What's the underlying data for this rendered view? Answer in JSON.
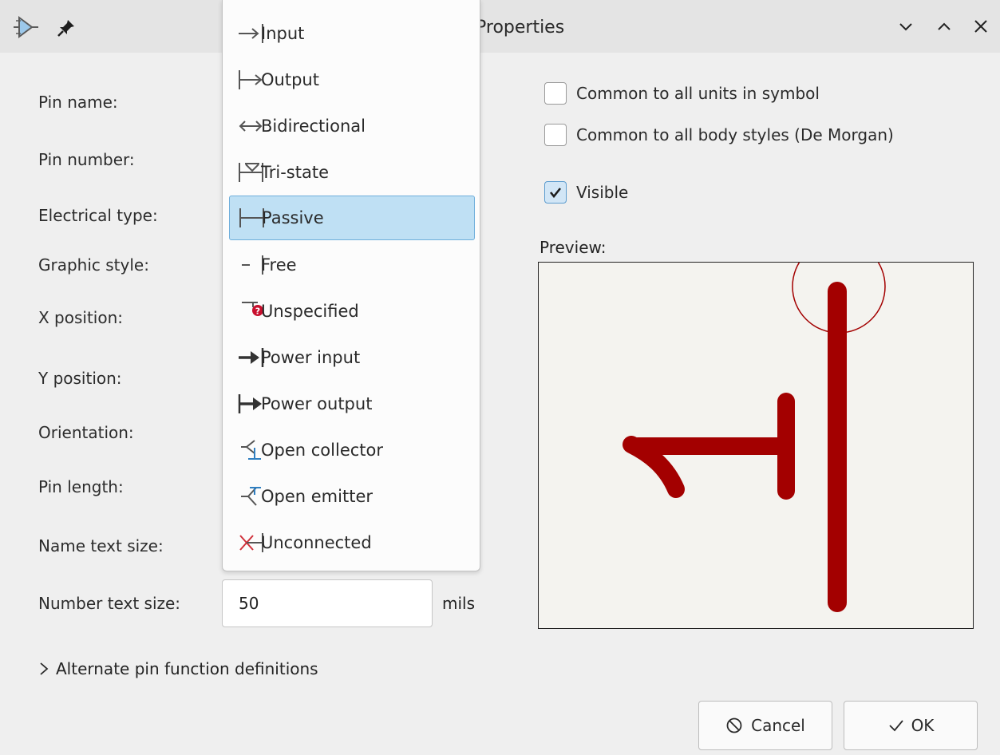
{
  "window": {
    "title": "Properties"
  },
  "form": {
    "pin_name_label": "Pin name:",
    "pin_number_label": "Pin number:",
    "electrical_type_label": "Electrical type:",
    "graphic_style_label": "Graphic style:",
    "x_position_label": "X position:",
    "y_position_label": "Y position:",
    "orientation_label": "Orientation:",
    "pin_length_label": "Pin length:",
    "name_text_size_label": "Name text size:",
    "number_text_size_label": "Number text size:",
    "number_text_size_value": "50",
    "number_text_size_unit": "mils"
  },
  "options": {
    "common_units_label": "Common to all units in symbol",
    "common_units_checked": false,
    "common_body_label": "Common to all body styles (De Morgan)",
    "common_body_checked": false,
    "visible_label": "Visible",
    "visible_checked": true
  },
  "preview": {
    "label": "Preview:",
    "pin_color": "#a30000"
  },
  "alternate": {
    "label": "Alternate pin function definitions"
  },
  "buttons": {
    "cancel": "Cancel",
    "ok": "OK"
  },
  "electrical_type_dropdown": {
    "selected": "Passive",
    "items": [
      {
        "label": "Input",
        "icon": "input-pin-icon"
      },
      {
        "label": "Output",
        "icon": "output-pin-icon"
      },
      {
        "label": "Bidirectional",
        "icon": "bidirectional-pin-icon"
      },
      {
        "label": "Tri-state",
        "icon": "tristate-pin-icon"
      },
      {
        "label": "Passive",
        "icon": "passive-pin-icon"
      },
      {
        "label": "Free",
        "icon": "free-pin-icon"
      },
      {
        "label": "Unspecified",
        "icon": "unspecified-pin-icon"
      },
      {
        "label": "Power input",
        "icon": "power-input-pin-icon"
      },
      {
        "label": "Power output",
        "icon": "power-output-pin-icon"
      },
      {
        "label": "Open collector",
        "icon": "open-collector-pin-icon"
      },
      {
        "label": "Open emitter",
        "icon": "open-emitter-pin-icon"
      },
      {
        "label": "Unconnected",
        "icon": "unconnected-pin-icon"
      }
    ]
  },
  "colors": {
    "selection_bg": "#bfe0f4",
    "selection_border": "#6eaedb",
    "open_collector_icon": "#2f7fc1",
    "unconnected_icon": "#d0303a",
    "unspecified_icon": "#c8102e"
  }
}
